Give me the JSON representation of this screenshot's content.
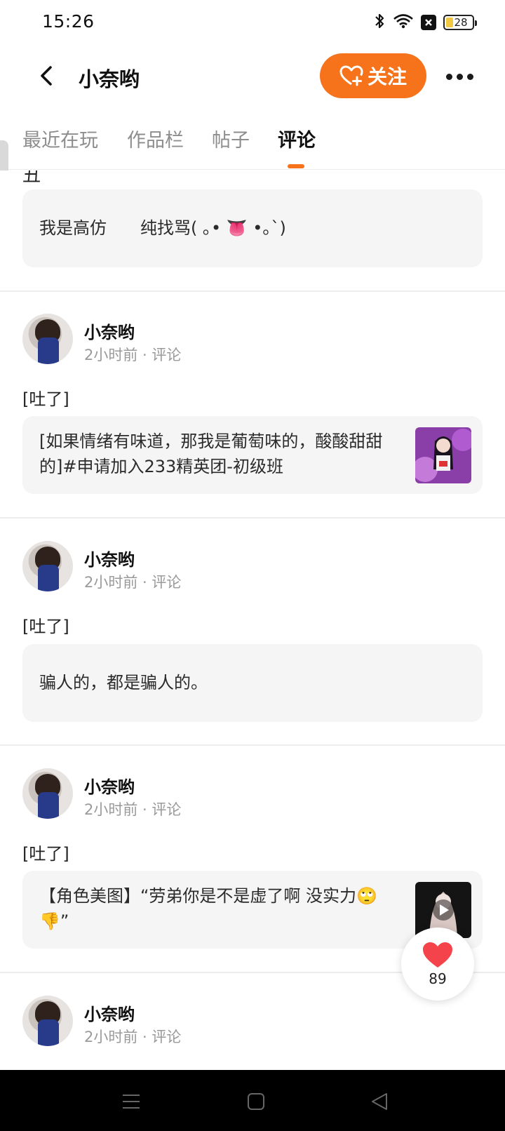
{
  "status_bar": {
    "time": "15:26",
    "battery": "28"
  },
  "header": {
    "title": "小奈哟",
    "follow_label": "关注"
  },
  "tabs": [
    {
      "label": "最近在玩"
    },
    {
      "label": "作品栏"
    },
    {
      "label": "帖子"
    },
    {
      "label": "评论",
      "active": true
    }
  ],
  "partial_top": {
    "char": "丑",
    "quote": "我是高仿　　纯找骂( ｡• 👅 •｡`)"
  },
  "feed": [
    {
      "username": "小奈哟",
      "meta": "2小时前 · 评论",
      "comment": "[吐了]",
      "quote_line1": "[如果情绪有味道，那我是葡萄味的，酸酸甜甜",
      "quote_line2": "的]#申请加入233精英团-初级班"
    },
    {
      "username": "小奈哟",
      "meta": "2小时前 · 评论",
      "comment": "[吐了]",
      "quote_line1": "骗人的，都是骗人的。",
      "quote_line2": ""
    },
    {
      "username": "小奈哟",
      "meta": "2小时前 · 评论",
      "comment": "[吐了]",
      "quote_line1": "【角色美图】“劳弟你是不是虚了啊 没实力🙄",
      "quote_line2": "👎”"
    },
    {
      "username": "小奈哟",
      "meta": "2小时前 · 评论",
      "comment": "",
      "quote_line1": "",
      "quote_line2": ""
    }
  ],
  "like_fab": {
    "count": "89"
  },
  "colors": {
    "accent": "#f7731b",
    "quote_bg": "#f5f5f5",
    "heart": "#f5434b"
  },
  "icons": [
    "bluetooth-icon",
    "wifi-icon",
    "battery-icon",
    "back-arrow-icon",
    "add-heart-icon",
    "more-icon",
    "heart-icon",
    "menu-icon",
    "home-square-icon",
    "back-triangle-icon"
  ]
}
